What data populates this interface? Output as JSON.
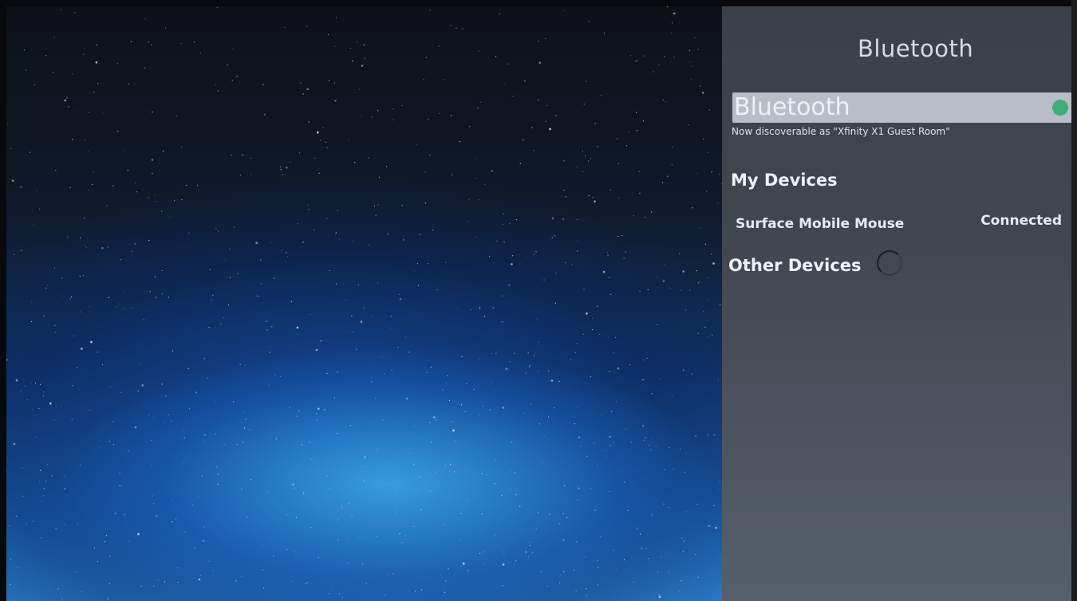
{
  "panel": {
    "title": "Bluetooth",
    "bluetooth_toggle": {
      "label": "Bluetooth",
      "state": "on",
      "indicator_color": "#3fae7a"
    },
    "discoverable_text": "Now discoverable as \"Xfinity X1 Guest Room\"",
    "my_devices": {
      "title": "My Devices",
      "devices": [
        {
          "name": "Surface Mobile Mouse",
          "status": "Connected"
        }
      ]
    },
    "other_devices": {
      "title": "Other Devices",
      "loading_icon": "spinner-icon"
    }
  }
}
